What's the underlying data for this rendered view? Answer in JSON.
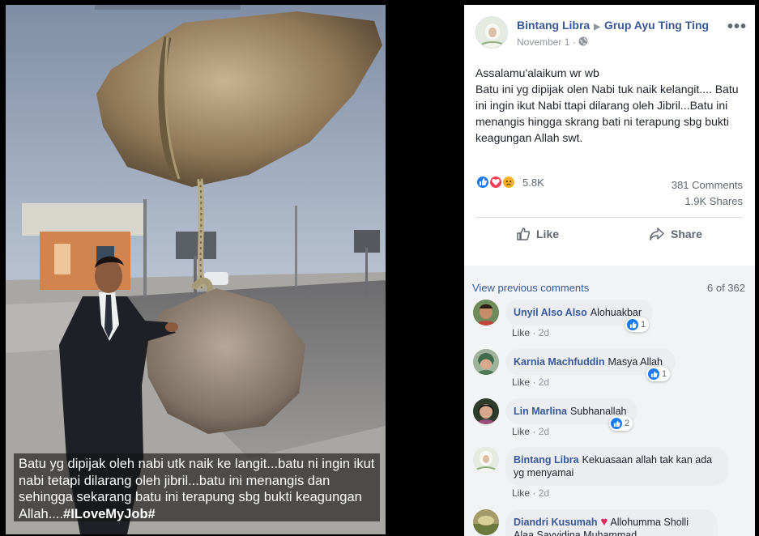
{
  "photo": {
    "caption_text": "Batu yg dipijak oleh nabi utk naik ke langit...batu ni ingin ikut nabi tetapi dilarang oleh jibril...batu ini menangis dan sehingga sekarang batu ini terapung sbg bukti keagungan Allah....",
    "caption_hashtag": "#ILoveMyJob#"
  },
  "post": {
    "author": "Bintang Libra",
    "group": "Grup Ayu Ting Ting",
    "date": "November 1",
    "more": "•••",
    "text_line1": "Assalamu'alaikum wr wb",
    "text_body": "Batu ini yg dipijak olen Nabi tuk naik kelangit.... Batu ini ingin ikut Nabi ttapi dilarang oleh Jibril...Batu ini menangis hingga skrang bati ni terapung sbg bukti keagungan Allah swt.",
    "reaction_count": "5.8K",
    "comments_count": "381 Comments",
    "shares_count": "1.9K Shares",
    "like_label": "Like",
    "share_label": "Share"
  },
  "colors": {
    "link_blue": "#385898",
    "like_blue": "#1877f2",
    "heart_red": "#f33e58",
    "haha_yellow": "#f7b125"
  },
  "comments": {
    "view_previous": "View previous comments",
    "count_of": "6 of 362",
    "like": "Like",
    "sep": "·",
    "items": [
      {
        "name": "Unyil Also Also",
        "text": "Alohuakbar",
        "time": "2d",
        "reactions": "1"
      },
      {
        "name": "Karnia Machfuddin",
        "text": "Masya Allah",
        "time": "2d",
        "reactions": "1"
      },
      {
        "name": "Lin Marlina",
        "text": "Subhanallah",
        "time": "2d",
        "reactions": "2"
      },
      {
        "name": "Bintang Libra",
        "text": "Kekuasaan allah tak kan ada yg menyamai",
        "time": "2d",
        "reactions": ""
      },
      {
        "name": "Diandri Kusumah",
        "text": "Allohumma Sholli Alaa Sayyidina Muhammad",
        "time": "",
        "reactions": ""
      }
    ]
  }
}
